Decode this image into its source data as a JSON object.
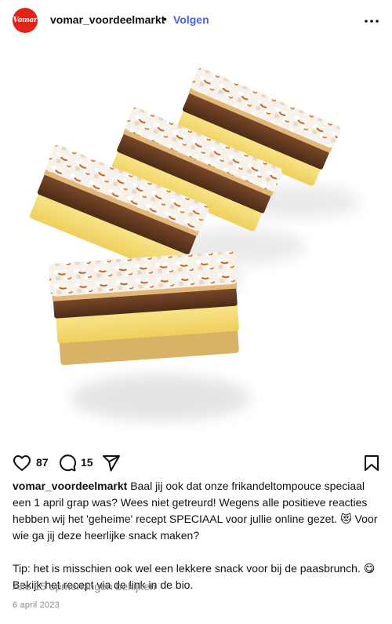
{
  "header": {
    "avatar_text": "Vomar",
    "username": "vomar_voordeelmarkt",
    "separator": "•",
    "follow_label": "Volgen",
    "more_icon": "more-horizontal-icon"
  },
  "actions": {
    "like_icon": "heart-icon",
    "like_count": "87",
    "comment_icon": "comment-icon",
    "comment_count": "15",
    "share_icon": "send-icon",
    "save_icon": "bookmark-icon"
  },
  "caption": {
    "username": "vomar_voordeelmarkt",
    "paragraph_1": "Baal jij ook dat onze frikandeltompouce speciaal een 1 april grap was? Wees niet getreurd! Wegens alle positieve reacties hebben wij het 'geheime' recept SPECIAAL voor jullie online gezet. 😻  Voor wie ga jij deze heerlijke snack maken?",
    "paragraph_2": "Tip: het is misschien ook wel een lekkere snack voor bij de paasbrunch. 😋 Bekijk het recept via de link in de bio."
  },
  "comments_link": "Alle 15 opmerkingen bekijken",
  "date": "6 april 2023"
}
